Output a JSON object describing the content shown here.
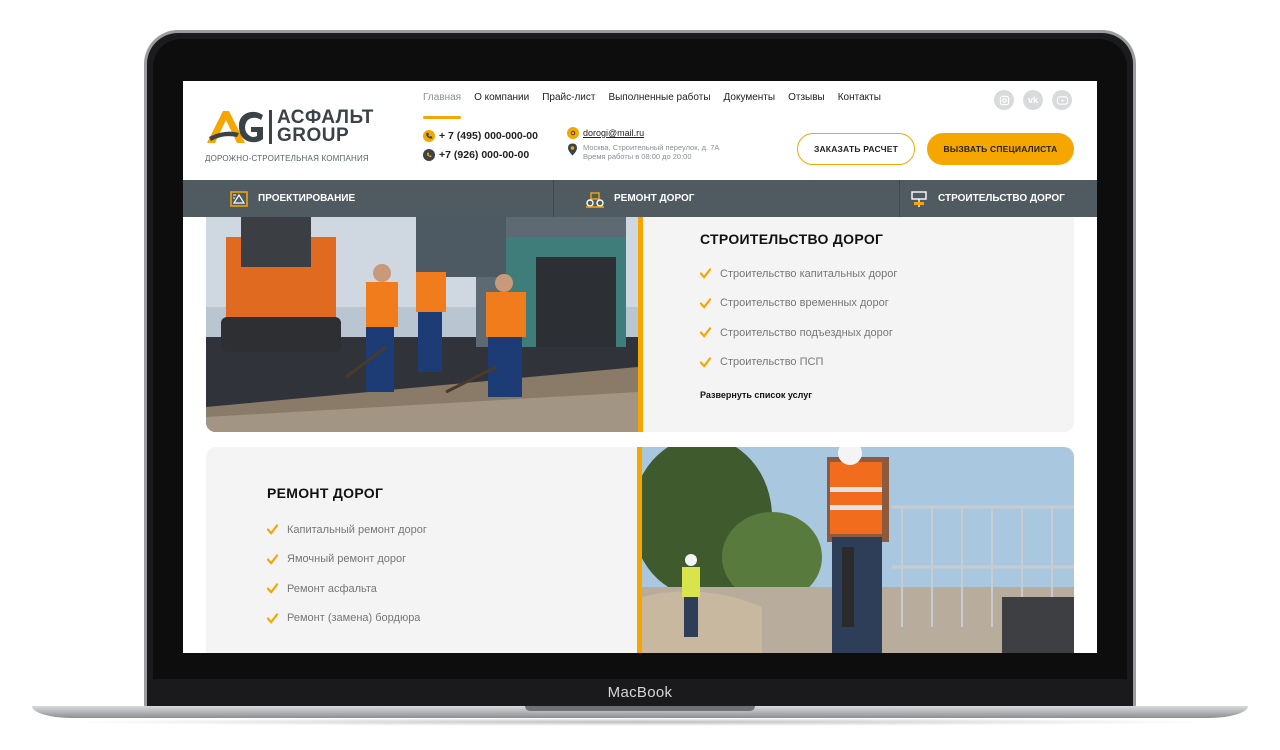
{
  "device": {
    "brand": "MacBook"
  },
  "logo": {
    "mark": "AG",
    "line1": "АСФАЛЬТ",
    "line2": "GROUP",
    "tagline": "ДОРОЖНО-СТРОИТЕЛЬНАЯ КОМПАНИЯ"
  },
  "nav": {
    "items": [
      {
        "label": "Главная",
        "active": true
      },
      {
        "label": "О компании"
      },
      {
        "label": "Прайс-лист"
      },
      {
        "label": "Выполненные работы"
      },
      {
        "label": "Документы"
      },
      {
        "label": "Отзывы"
      },
      {
        "label": "Контакты"
      }
    ]
  },
  "socials": {
    "instagram": "instagram-icon",
    "vk": "vk-icon",
    "youtube": "youtube-icon"
  },
  "contacts": {
    "phone1": "+ 7 (495) 000-000-00",
    "phone2": "+7 (926) 000-00-00",
    "email": "dorogi@mail.ru",
    "address": "Москва, Строительный переулок, д. 7А",
    "hours": "Время работы в 08:00 до 20:00"
  },
  "buttons": {
    "order_calc": "ЗАКАЗАТЬ РАСЧЕТ",
    "call_specialist": "ВЫЗВАТЬ СПЕЦИАЛИСТА"
  },
  "services_bar": {
    "design": "ПРОЕКТИРОВАНИЕ",
    "repair": "РЕМОНТ ДОРОГ",
    "construction": "СТРОИТЕЛЬСТВО ДОРОГ"
  },
  "construction_card": {
    "title": "СТРОИТЕЛЬСТВО ДОРОГ",
    "items": [
      "Строительство капитальных дорог",
      "Строительство временных дорог",
      "Строительство подъездных дорог",
      "Строительство ПСП"
    ],
    "expand": "Развернуть список услуг"
  },
  "repair_card": {
    "title": "РЕМОНТ ДОРОГ",
    "items": [
      "Капитальный ремонт дорог",
      "Ямочный ремонт дорог",
      "Ремонт асфальта",
      "Ремонт (замена) бордюра"
    ]
  },
  "colors": {
    "accent": "#f5a700",
    "dark": "#4f5a61",
    "card": "#f4f4f4"
  }
}
